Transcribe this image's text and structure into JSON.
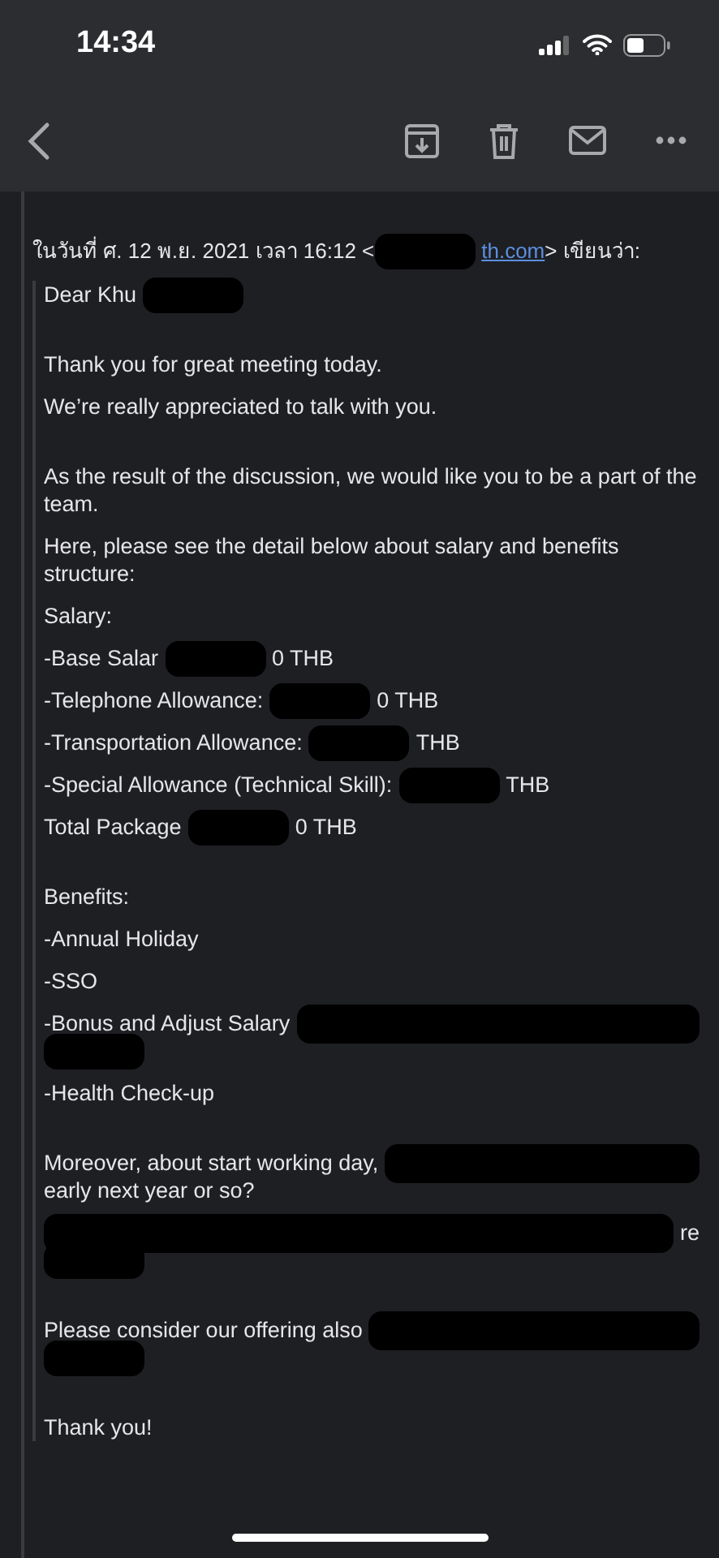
{
  "status_bar": {
    "time": "14:34"
  },
  "toolbar": {
    "buttons": [
      {
        "kind": "archive"
      },
      {
        "kind": "trash"
      },
      {
        "kind": "mail"
      },
      {
        "kind": "more"
      }
    ]
  },
  "quote_header": [
    {
      "kind": "text",
      "text": "ในวันที่ ศ. 12 พ.ย. 2021 เวลา 16:12 <"
    },
    {
      "kind": "redacted"
    },
    {
      "kind": "link",
      "text": "th.com"
    },
    {
      "kind": "text",
      "text": "> เขียนว่า:"
    }
  ],
  "blocks": [
    [
      {
        "lines": [
          [
            {
              "kind": "text",
              "text": "Dear Khu"
            },
            {
              "kind": "redacted"
            }
          ]
        ]
      }
    ],
    [
      {
        "lines": [
          [
            {
              "kind": "text",
              "text": "Thank you for great meeting today."
            }
          ]
        ]
      },
      {
        "lines": [
          [
            {
              "kind": "text",
              "text": "We’re really appreciated to talk with you."
            }
          ]
        ]
      }
    ],
    [
      {
        "lines": [
          [
            {
              "kind": "text",
              "text": "As the result of the discussion, we would like you to be a part of the team."
            }
          ]
        ]
      },
      {
        "lines": [
          [
            {
              "kind": "text",
              "text": "Here, please see the detail below about salary and benefits structure:"
            }
          ]
        ]
      },
      {
        "lines": [
          [
            {
              "kind": "text",
              "text": "Salary:"
            }
          ]
        ]
      },
      {
        "lines": [
          [
            {
              "kind": "text",
              "text": "-Base Salar"
            },
            {
              "kind": "redacted"
            },
            {
              "kind": "text",
              "text": "0 THB"
            }
          ]
        ]
      },
      {
        "lines": [
          [
            {
              "kind": "text",
              "text": "-Telephone Allowance:"
            },
            {
              "kind": "redacted"
            },
            {
              "kind": "text",
              "text": "0 THB"
            }
          ]
        ]
      },
      {
        "lines": [
          [
            {
              "kind": "text",
              "text": "-Transportation Allowance:"
            },
            {
              "kind": "redacted"
            },
            {
              "kind": "text",
              "text": "THB"
            }
          ]
        ]
      },
      {
        "lines": [
          [
            {
              "kind": "text",
              "text": "-Special Allowance (Technical Skill):"
            },
            {
              "kind": "redacted"
            },
            {
              "kind": "text",
              "text": "THB"
            }
          ]
        ]
      },
      {
        "lines": [
          [
            {
              "kind": "text",
              "text": "Total Package"
            },
            {
              "kind": "redacted"
            },
            {
              "kind": "text",
              "text": "0 THB"
            }
          ]
        ]
      }
    ],
    [
      {
        "lines": [
          [
            {
              "kind": "text",
              "text": "Benefits:"
            }
          ]
        ]
      },
      {
        "lines": [
          [
            {
              "kind": "text",
              "text": "-Annual Holiday"
            }
          ]
        ]
      },
      {
        "lines": [
          [
            {
              "kind": "text",
              "text": "-SSO"
            }
          ]
        ]
      },
      {
        "lines": [
          [
            {
              "kind": "text",
              "text": "-Bonus and Adjust Salary"
            },
            {
              "kind": "redacted_fill"
            }
          ],
          [
            {
              "kind": "redacted"
            }
          ]
        ]
      },
      {
        "lines": [
          [
            {
              "kind": "text",
              "text": "-Health Check-up"
            }
          ]
        ]
      }
    ],
    [
      {
        "lines": [
          [
            {
              "kind": "text",
              "text": "Moreover, about start working day,"
            },
            {
              "kind": "redacted_fill"
            }
          ],
          [
            {
              "kind": "text",
              "text": "early next year or so?"
            }
          ]
        ]
      },
      {
        "lines": [
          [
            {
              "kind": "redacted_fill"
            },
            {
              "kind": "text",
              "text": "re"
            }
          ],
          [
            {
              "kind": "redacted"
            }
          ]
        ]
      }
    ],
    [
      {
        "lines": [
          [
            {
              "kind": "text",
              "text": "Please consider our offering also"
            },
            {
              "kind": "redacted_fill"
            }
          ],
          [
            {
              "kind": "redacted"
            }
          ]
        ]
      }
    ],
    [
      {
        "lines": [
          [
            {
              "kind": "text",
              "text": "Thank you!"
            }
          ]
        ]
      }
    ]
  ]
}
